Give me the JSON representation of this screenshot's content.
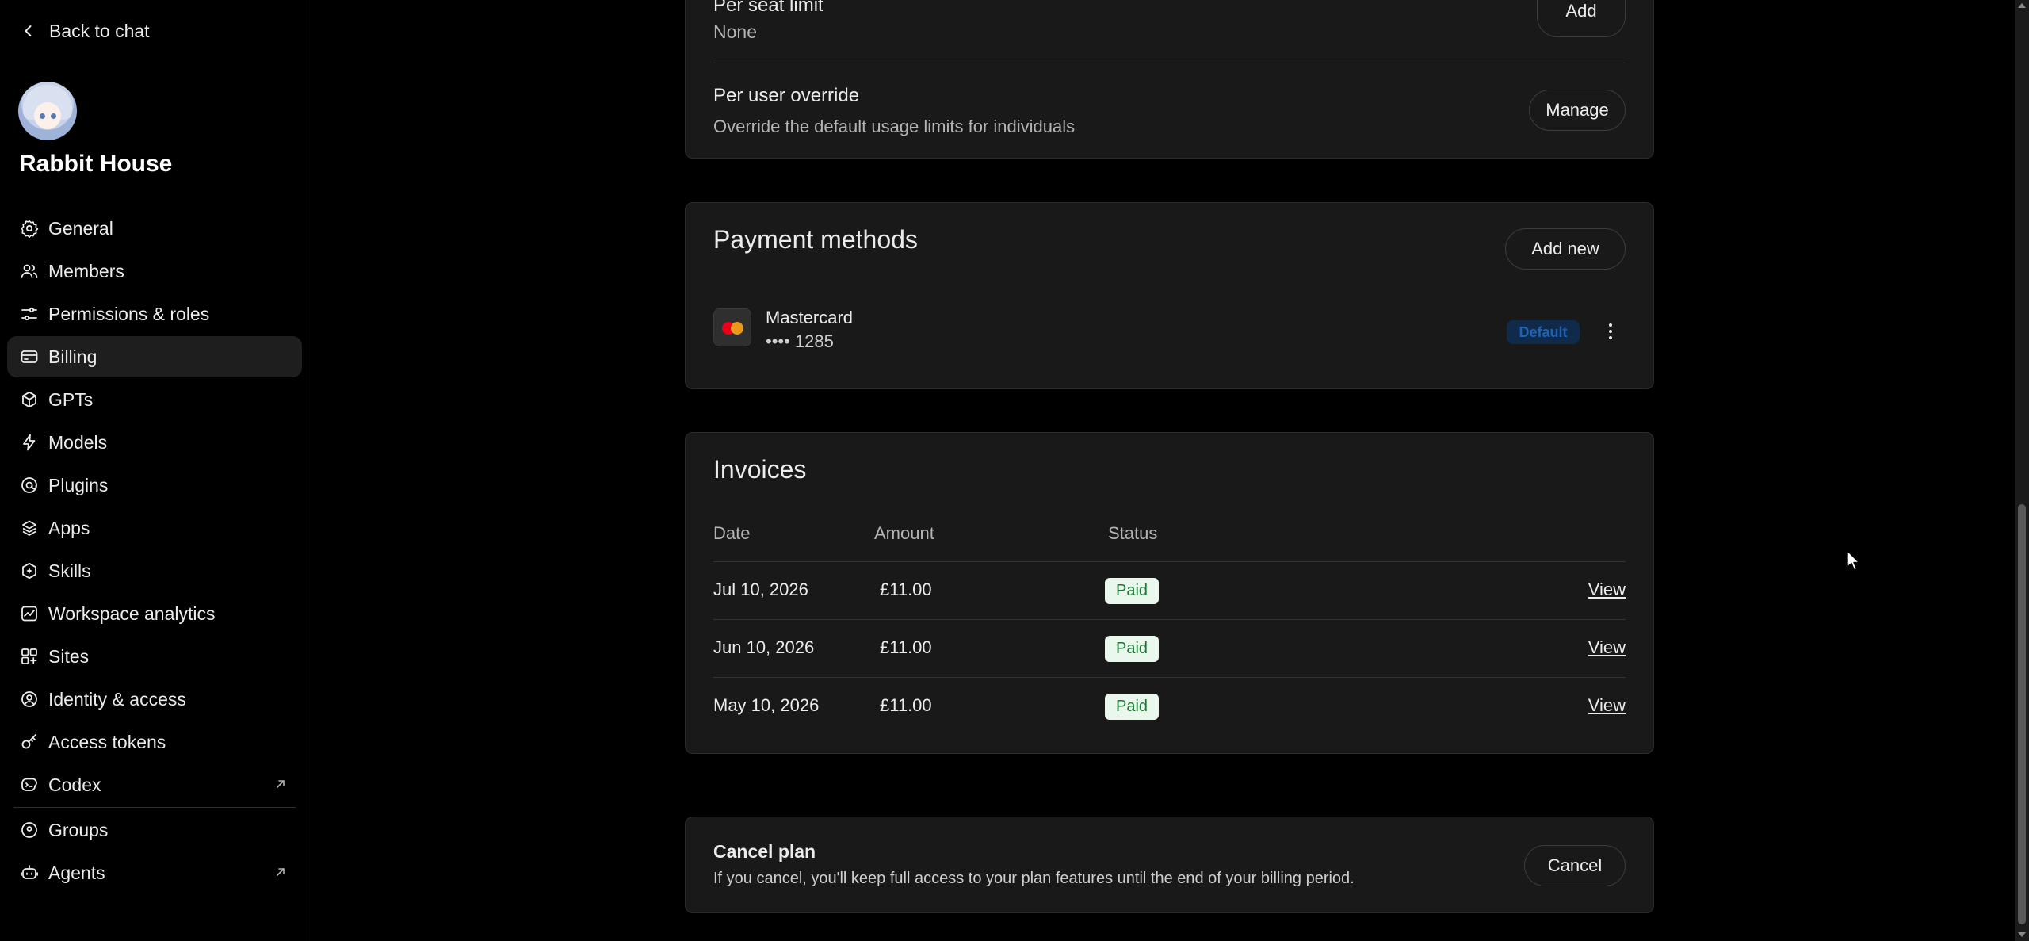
{
  "sidebar": {
    "back_label": "Back to chat",
    "workspace_name": "Rabbit House",
    "items": [
      {
        "label": "General",
        "icon": "gear-icon"
      },
      {
        "label": "Members",
        "icon": "users-icon"
      },
      {
        "label": "Permissions & roles",
        "icon": "sliders-icon"
      },
      {
        "label": "Billing",
        "icon": "credit-card-icon",
        "active": true
      },
      {
        "label": "GPTs",
        "icon": "cube-icon"
      },
      {
        "label": "Models",
        "icon": "sparkle-icon"
      },
      {
        "label": "Plugins",
        "icon": "plugin-icon"
      },
      {
        "label": "Apps",
        "icon": "apps-icon"
      },
      {
        "label": "Skills",
        "icon": "skills-icon"
      },
      {
        "label": "Workspace analytics",
        "icon": "analytics-icon"
      },
      {
        "label": "Sites",
        "icon": "sites-icon"
      },
      {
        "label": "Identity & access",
        "icon": "identity-icon"
      },
      {
        "label": "Access tokens",
        "icon": "key-icon"
      },
      {
        "label": "Codex",
        "icon": "codex-icon",
        "external": true
      },
      {
        "label": "Groups",
        "icon": "groups-icon"
      },
      {
        "label": "Agents",
        "icon": "agent-icon",
        "external": true
      }
    ]
  },
  "usage_limits": {
    "per_seat_label": "Per seat limit",
    "per_seat_value": "None",
    "add_label": "Add",
    "per_user_label": "Per user override",
    "per_user_desc": "Override the default usage limits for individuals",
    "manage_label": "Manage"
  },
  "payment_methods": {
    "title": "Payment methods",
    "add_new_label": "Add new",
    "card_brand": "Mastercard",
    "card_number": "•••• 1285",
    "default_badge": "Default"
  },
  "invoices": {
    "title": "Invoices",
    "columns": [
      "Date",
      "Amount",
      "Status"
    ],
    "rows": [
      {
        "date": "Jul 10, 2026",
        "amount": "£11.00",
        "status": "Paid",
        "action": "View"
      },
      {
        "date": "Jun 10, 2026",
        "amount": "£11.00",
        "status": "Paid",
        "action": "View"
      },
      {
        "date": "May 10, 2026",
        "amount": "£11.00",
        "status": "Paid",
        "action": "View"
      }
    ]
  },
  "cancel_plan": {
    "title": "Cancel plan",
    "desc": "If you cancel, you'll keep full access to your plan features until the end of your billing period.",
    "button_label": "Cancel"
  },
  "colors": {
    "background": "#000000",
    "card": "#191919",
    "paid_badge_bg": "#eaf7ec",
    "paid_badge_text": "#1c7a34",
    "default_badge_text": "#1e63b8"
  }
}
